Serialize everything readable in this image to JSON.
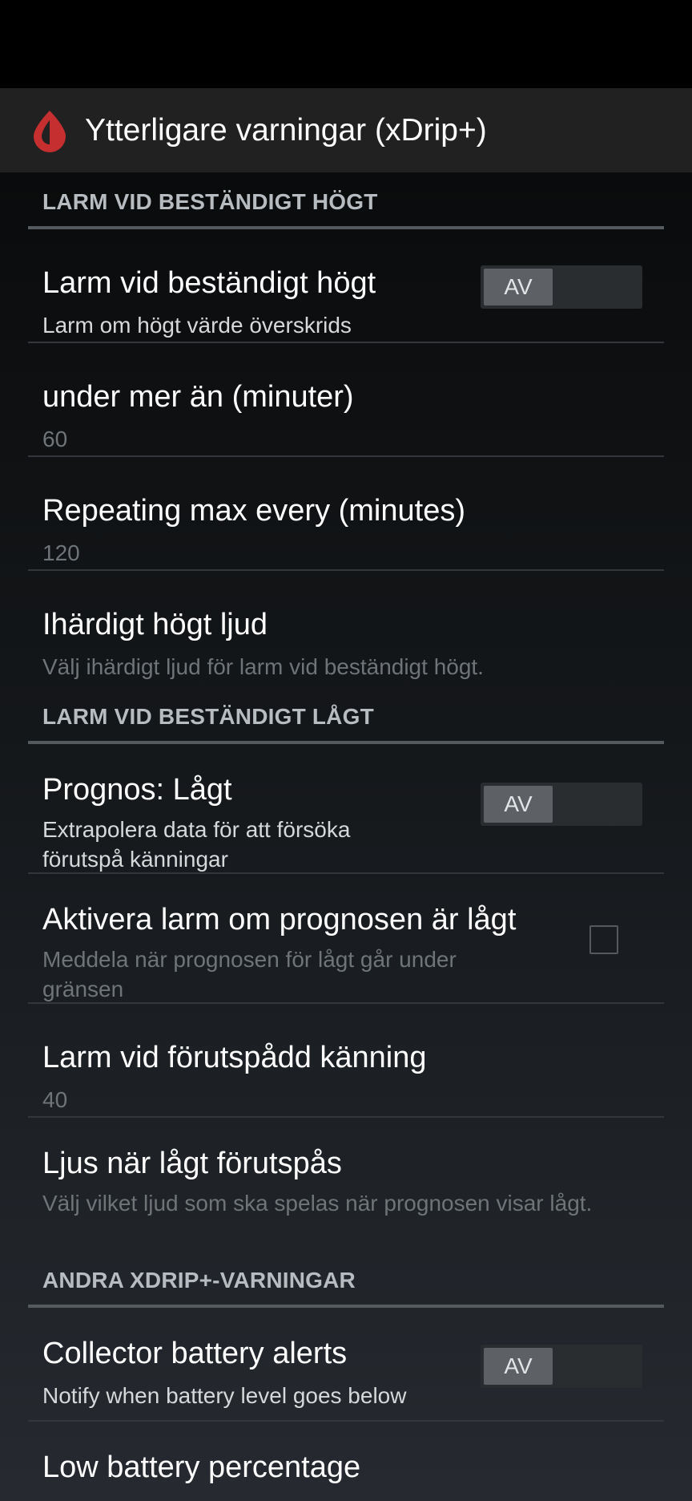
{
  "app": {
    "title": "Ytterligare varningar (xDrip+)",
    "icon": "drop-icon",
    "accent_color": "#c62f2f"
  },
  "sections": [
    {
      "title": "LARM VID BESTÄNDIGT HÖGT",
      "items": [
        {
          "title": "Larm vid beständigt högt",
          "summary": "Larm om högt värde överskrids",
          "switch_label": "AV",
          "switch_on": false
        },
        {
          "title": "under mer än (minuter)",
          "summary": "60"
        },
        {
          "title": "Repeating max every (minutes)",
          "summary": "120"
        },
        {
          "title": "Ihärdigt högt ljud",
          "summary": "Välj ihärdigt ljud för larm vid beständigt högt."
        }
      ]
    },
    {
      "title": "LARM VID BESTÄNDIGT LÅGT",
      "items": [
        {
          "title": "Prognos: Lågt",
          "summary": "Extrapolera data för att försöka förutspå känningar",
          "switch_label": "AV",
          "switch_on": false
        },
        {
          "title": "Aktivera larm om prognosen är lågt",
          "summary": "Meddela när prognosen för lågt går under gränsen",
          "checked": false
        },
        {
          "title": "Larm vid förutspådd känning",
          "summary": "40"
        },
        {
          "title": "Ljus när lågt förutspås",
          "summary": "Välj vilket ljud som ska spelas när prognosen visar lågt."
        }
      ]
    },
    {
      "title": "ANDRA XDRIP+-VARNINGAR",
      "items": [
        {
          "title": "Collector battery alerts",
          "summary": "Notify when battery level goes below",
          "switch_label": "AV",
          "switch_on": false
        },
        {
          "title": "Low battery percentage"
        }
      ]
    }
  ]
}
